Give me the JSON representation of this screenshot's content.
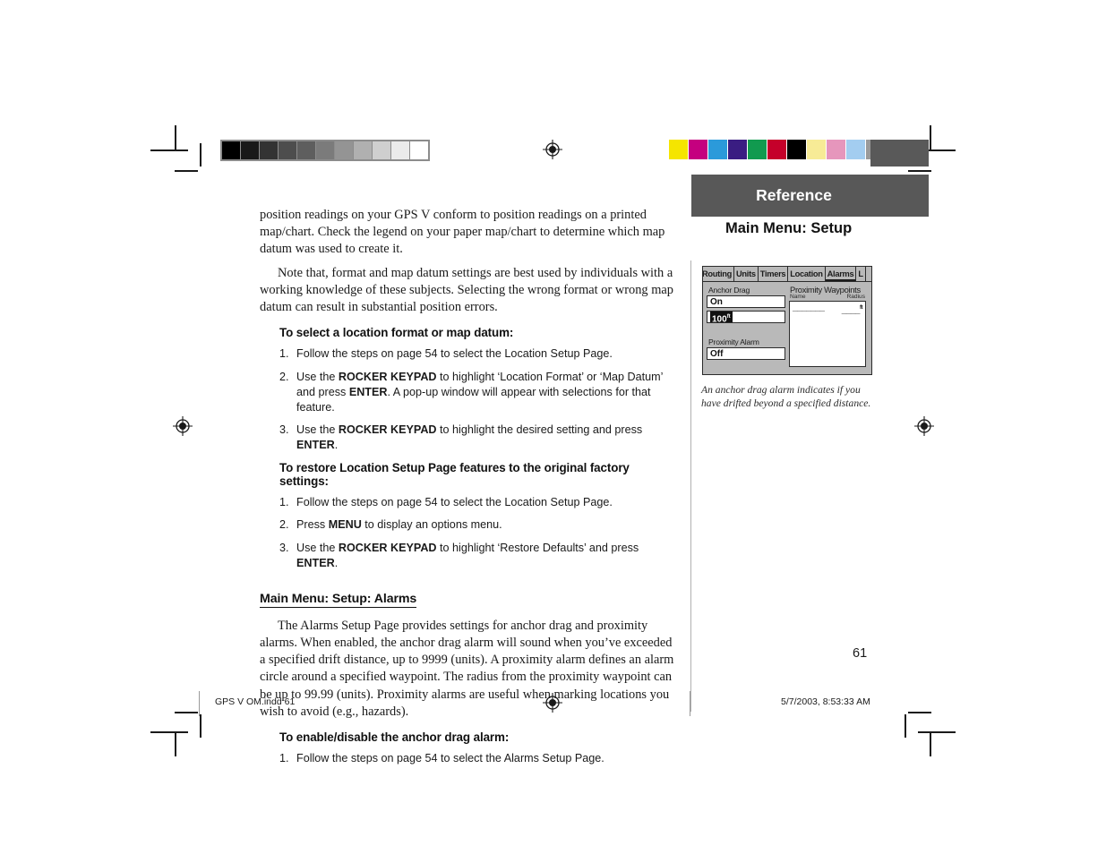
{
  "page": {
    "number": "61",
    "running_head": "Reference",
    "subhead": "Main Menu: Setup"
  },
  "calibration": {
    "grayscale_steps": [
      "#000000",
      "#191919",
      "#333333",
      "#4d4d4d",
      "#5e5e5e",
      "#7b7b7b",
      "#949494",
      "#b0b0b0",
      "#cfcfcf",
      "#ebebeb",
      "#ffffff"
    ],
    "color_swatches": [
      "#f5e500",
      "#c5007f",
      "#2b9ada",
      "#3a1d82",
      "#119a4f",
      "#c5002a",
      "#000000",
      "#f7eb96",
      "#e696bc",
      "#a3cdf0",
      "#9a9a9a"
    ]
  },
  "left_column": {
    "paragraphs": [
      {
        "id": "p1",
        "text": "position readings on your GPS V conform to position readings on a printed map/chart.  Check the legend on your paper map/chart to determine which map datum was used to create it."
      },
      {
        "id": "p2",
        "text": "Note that, format and map datum settings are best used by individuals with a working knowledge of these subjects.  Selecting the wrong format or wrong map datum can result in substantial position errors."
      }
    ],
    "heading_1": "To select a location format or map datum:",
    "steps_1": [
      {
        "num": "1.",
        "text": "Follow the steps on page 54 to select the Location Setup Page."
      },
      {
        "num": "2.",
        "html": "Use the <b>ROCKER KEYPAD</b> to highlight ‘Location Format’ or ‘Map Datum’ and press <b>ENTER</b>. A pop-up window will appear with selections for that feature."
      },
      {
        "num": "3.",
        "html": "Use the <b>ROCKER KEYPAD</b> to highlight the desired setting and press <b>ENTER</b>."
      }
    ],
    "heading_2": "To restore Location Setup Page features to the original factory settings:",
    "steps_2": [
      {
        "num": "1.",
        "text": "Follow the steps on page 54 to select the Location Setup Page."
      },
      {
        "num": "2.",
        "html": "Press <b>MENU</b> to display an options menu."
      },
      {
        "num": "3.",
        "html": "Use the <b>ROCKER KEYPAD</b> to highlight ‘Restore Defaults’ and press <b>ENTER</b>."
      }
    ],
    "section_heading": "Main Menu: Setup: Alarms",
    "paragraph_3": "The Alarms Setup Page provides settings for anchor drag and proximity alarms.  When enabled, the anchor drag alarm will sound when you’ve exceeded a specified drift distance, up to 9999 (units).  A proximity alarm defines an alarm circle around a specified waypoint.  The radius from the proximity waypoint can be up to 99.99 (units).  Proximity alarms are useful when marking locations you wish to avoid (e.g., hazards).",
    "heading_3": "To enable/disable the anchor drag alarm:",
    "steps_3": [
      {
        "num": "1.",
        "text": "Follow the steps on page 54 to select the Alarms Setup Page."
      }
    ]
  },
  "gps_screen": {
    "tabs": [
      {
        "label": "Routing",
        "active": false,
        "clipped": true
      },
      {
        "label": "Units",
        "active": false,
        "clipped": false
      },
      {
        "label": "Timers",
        "active": false,
        "clipped": false
      },
      {
        "label": "Location",
        "active": false,
        "clipped": false
      },
      {
        "label": "Alarms",
        "active": true,
        "clipped": false
      },
      {
        "label": "L",
        "active": false,
        "clipped": false
      }
    ],
    "anchor_drag": {
      "label": "Anchor Drag",
      "state_value": "On",
      "distance_value": "100",
      "distance_unit": "ft"
    },
    "proximity_alarm": {
      "label": "Proximity Alarm",
      "state_value": "Off"
    },
    "proximity_waypoints": {
      "title": "Proximity Waypoints",
      "col_name": "Name",
      "col_radius": "Radius",
      "rows": [
        {
          "name": "_______",
          "radius": "____",
          "radius_unit": "ft"
        }
      ]
    }
  },
  "caption": "An anchor drag alarm indicates if you have drifted beyond a specified distance.",
  "footer": {
    "file_label": "GPS V OM.indd   61",
    "timestamp": "5/7/2003, 8:53:33 AM"
  }
}
